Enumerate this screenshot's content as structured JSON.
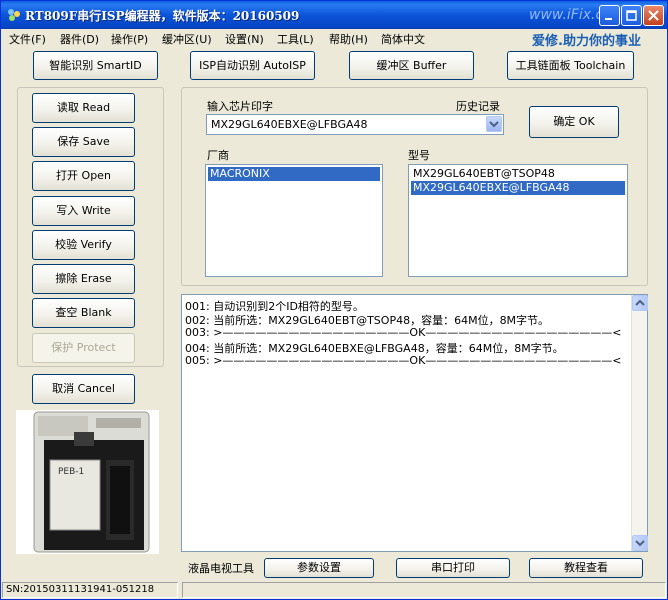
{
  "window": {
    "title": "RT809F串行ISP编程器，软件版本：20160509",
    "watermark": "www.iFix.cc"
  },
  "menu": {
    "items": [
      "文件(F)",
      "器件(D)",
      "操作(P)",
      "缓冲区(U)",
      "设置(N)",
      "工具(L)",
      "帮助(H)",
      "简体中文"
    ],
    "slogan": "爱修.助力你的事业"
  },
  "toolbar": {
    "smartid": "智能识别 SmartID",
    "isp_auto": "ISP自动识别 AutoISP",
    "buffer": "缓冲区 Buffer",
    "toolchain": "工具链面板 Toolchain"
  },
  "side_buttons": {
    "read": "读取 Read",
    "save": "保存 Save",
    "open": "打开 Open",
    "write": "写入 Write",
    "verify": "校验 Verify",
    "erase": "擦除 Erase",
    "blank": "查空 Blank",
    "protect": "保护 Protect",
    "cancel": "取消 Cancel"
  },
  "chip": {
    "input_label": "输入芯片印字",
    "history_label": "历史记录",
    "value": "MX29GL640EBXE@LFBGA48",
    "ok": "确定 OK",
    "vendor_label": "厂商",
    "model_label": "型号",
    "vendors": [
      "MACRONIX"
    ],
    "models": [
      "MX29GL640EBT@TSOP48",
      "MX29GL640EBXE@LFBGA48"
    ]
  },
  "log": {
    "lines": [
      "001: 自动识别到2个ID相符的型号。",
      "002: 当前所选：MX29GL640EBT@TSOP48，容量：64M位，8M字节。",
      "003: >—————————————————OK—————————————————<",
      "004: 当前所选：MX29GL640EBXE@LFBGA48，容量：64M位，8M字节。",
      "005: >—————————————————OK—————————————————<"
    ]
  },
  "bottom": {
    "lcd_tool": "液晶电视工具",
    "params": "参数设置",
    "serial": "串口打印",
    "tutorial": "教程查看"
  },
  "status": {
    "sn": "SN:20150311131941-051218",
    "message": ""
  },
  "device_label": "PEB-1",
  "colors": {
    "titlebar": "#0a54d8",
    "selection": "#316ac5",
    "slogan": "#1a5fb4"
  }
}
